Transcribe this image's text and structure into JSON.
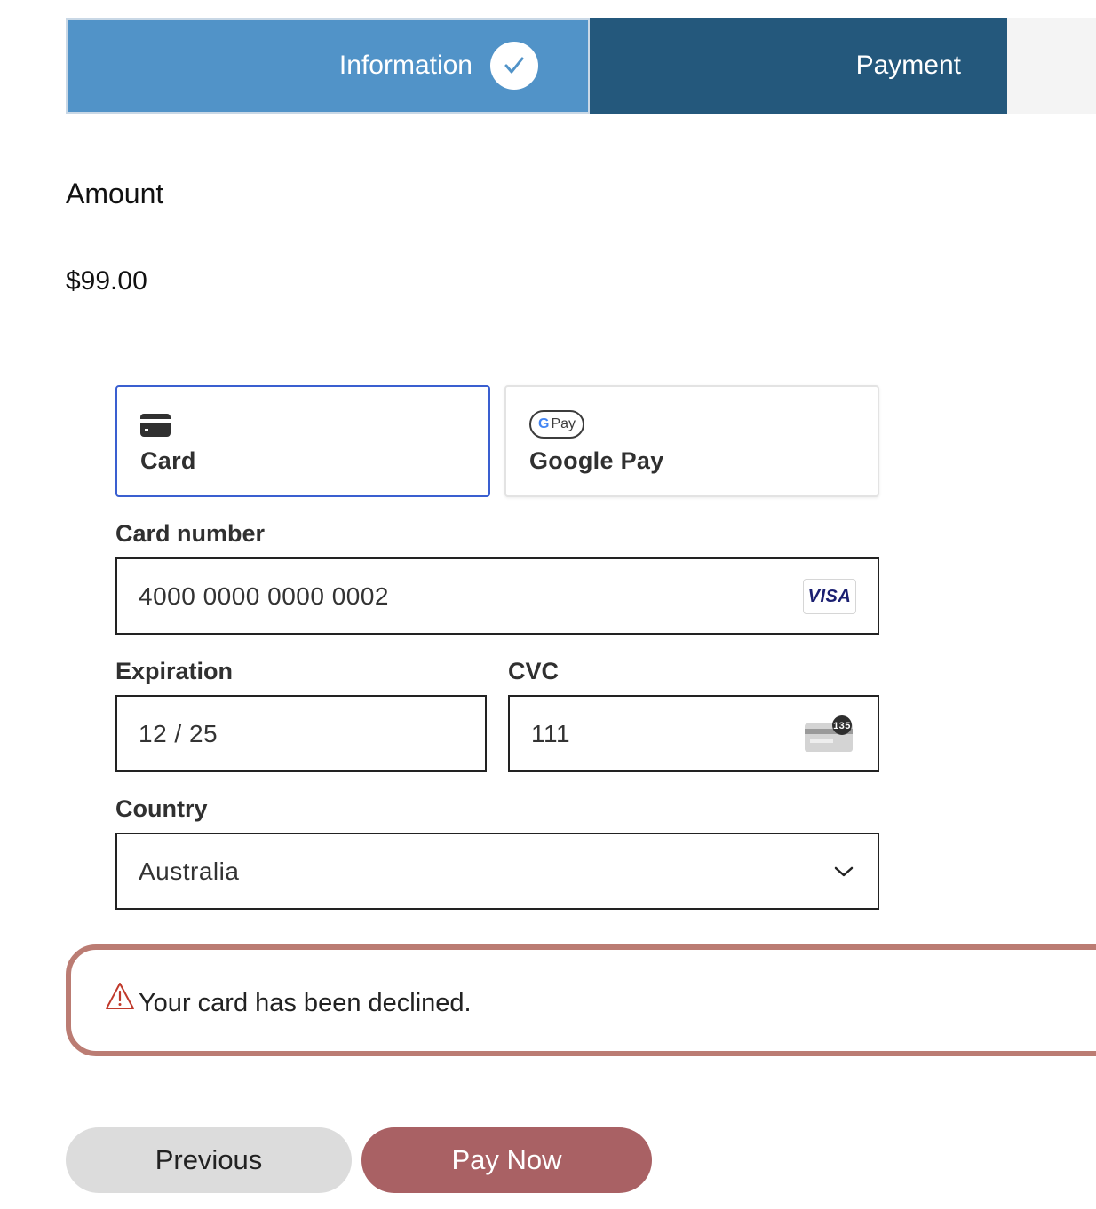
{
  "steps": {
    "information": "Information",
    "payment": "Payment"
  },
  "amount": {
    "label": "Amount",
    "value": "$99.00"
  },
  "payment_methods": {
    "card": "Card",
    "google_pay": "Google Pay",
    "google_pay_badge_pay": "Pay",
    "google_pay_badge_g": "G"
  },
  "card_number": {
    "label": "Card number",
    "value": "4000 0000 0000 0002",
    "brand": "VISA"
  },
  "expiration": {
    "label": "Expiration",
    "value": "12 / 25"
  },
  "cvc": {
    "label": "CVC",
    "value": "111",
    "icon_text": "135"
  },
  "country": {
    "label": "Country",
    "value": "Australia"
  },
  "error": {
    "message": "Your card has been declined."
  },
  "buttons": {
    "previous": "Previous",
    "pay_now": "Pay Now"
  },
  "colors": {
    "step_active": "#5193c8",
    "step_current": "#24587c",
    "card_tab_border": "#3a5fd0",
    "error_border": "#bb7c73",
    "pay_button": "#a96164",
    "previous_button": "#dcdcdc"
  }
}
